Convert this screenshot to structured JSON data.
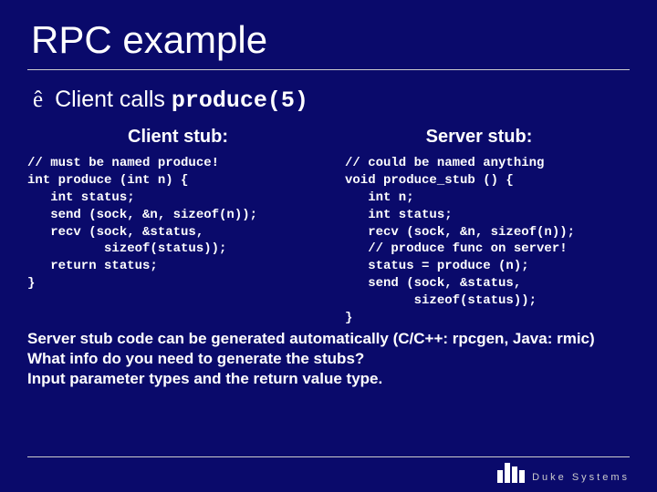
{
  "title": "RPC example",
  "bullet": {
    "symbol": "ê",
    "prefix": "Client calls ",
    "code": "produce(5)"
  },
  "cols": {
    "left_head": "Client stub:",
    "right_head": "Server stub:",
    "left_code": "// must be named produce!\nint produce (int n) {\n   int status;\n   send (sock, &n, sizeof(n));\n   recv (sock, &status,\n          sizeof(status));\n   return status;\n}",
    "right_code": "// could be named anything\nvoid produce_stub () {\n   int n;\n   int status;\n   recv (sock, &n, sizeof(n));\n   // produce func on server!\n   status = produce (n);\n   send (sock, &status,\n         sizeof(status));\n}"
  },
  "footer": {
    "l1": "Server stub code can be generated automatically (C/C++: rpcgen, Java: rmic)",
    "l2": "What info do you need to generate the stubs?",
    "l3": "Input parameter types and the return value type."
  },
  "logo_text": "Duke Systems"
}
